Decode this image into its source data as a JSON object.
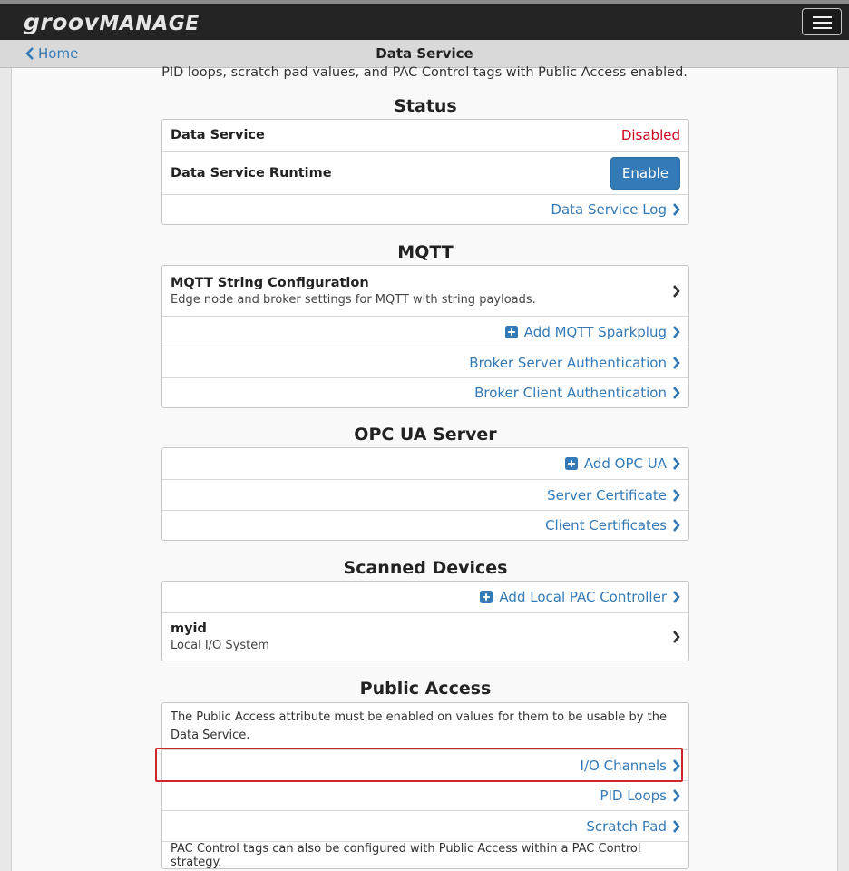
{
  "app": {
    "logo_bold": "groov",
    "logo_rest": "MANAGE"
  },
  "nav": {
    "back_label": "Home",
    "page_title": "Data Service"
  },
  "intro_text": "PID loops, scratch pad values, and PAC Control tags with Public Access enabled.",
  "status": {
    "title": "Status",
    "data_service_label": "Data Service",
    "data_service_value": "Disabled",
    "runtime_label": "Data Service Runtime",
    "enable_label": "Enable",
    "log_link": "Data Service Log"
  },
  "mqtt": {
    "title": "MQTT",
    "config_title": "MQTT String Configuration",
    "config_desc": "Edge node and broker settings for MQTT with string payloads.",
    "add_sparkplug": "Add MQTT Sparkplug",
    "broker_server_auth": "Broker Server Authentication",
    "broker_client_auth": "Broker Client Authentication"
  },
  "opcua": {
    "title": "OPC UA Server",
    "add_opcua": "Add OPC UA",
    "server_cert": "Server Certificate",
    "client_certs": "Client Certificates"
  },
  "scanned": {
    "title": "Scanned Devices",
    "add_local": "Add Local PAC Controller",
    "device_name": "myid",
    "device_desc": "Local I/O System"
  },
  "public_access": {
    "title": "Public Access",
    "note_top": "The Public Access attribute must be enabled on values for them to be usable by the Data Service.",
    "io_channels": "I/O Channels",
    "pid_loops": "PID Loops",
    "scratch_pad": "Scratch Pad",
    "note_bottom": "PAC Control tags can also be configured with Public Access within a PAC Control strategy."
  },
  "colors": {
    "link": "#337ab7",
    "disabled": "#d0021b",
    "button": "#337ab7",
    "highlight": "#d0262b"
  }
}
